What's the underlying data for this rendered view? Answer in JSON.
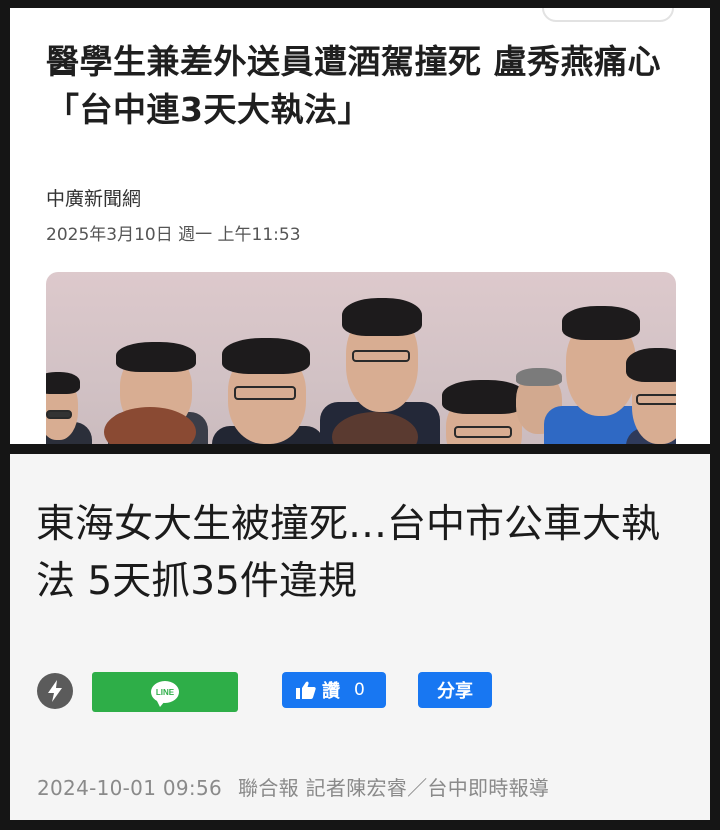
{
  "article1": {
    "headline": "醫學生兼差外送員遭酒駕撞死 盧秀燕痛心「台中連3天大執法」",
    "source": "中廣新聞網",
    "date": "2025年3月10日 週一 上午11:53"
  },
  "article2": {
    "headline": "東海女大生被撞死…台中市公車大執法 5天抓35件違規",
    "like_label": "讚",
    "like_count": "0",
    "share_label": "分享",
    "line_label": "LINE",
    "timestamp": "2024-10-01 09:56",
    "byline": "聯合報 記者陳宏睿／台中即時報導"
  },
  "icons": {
    "flash": "lightning-icon",
    "line": "line-icon",
    "like": "thumbs-up-icon"
  },
  "colors": {
    "line_green": "#2eae48",
    "facebook_blue": "#1877f2"
  }
}
